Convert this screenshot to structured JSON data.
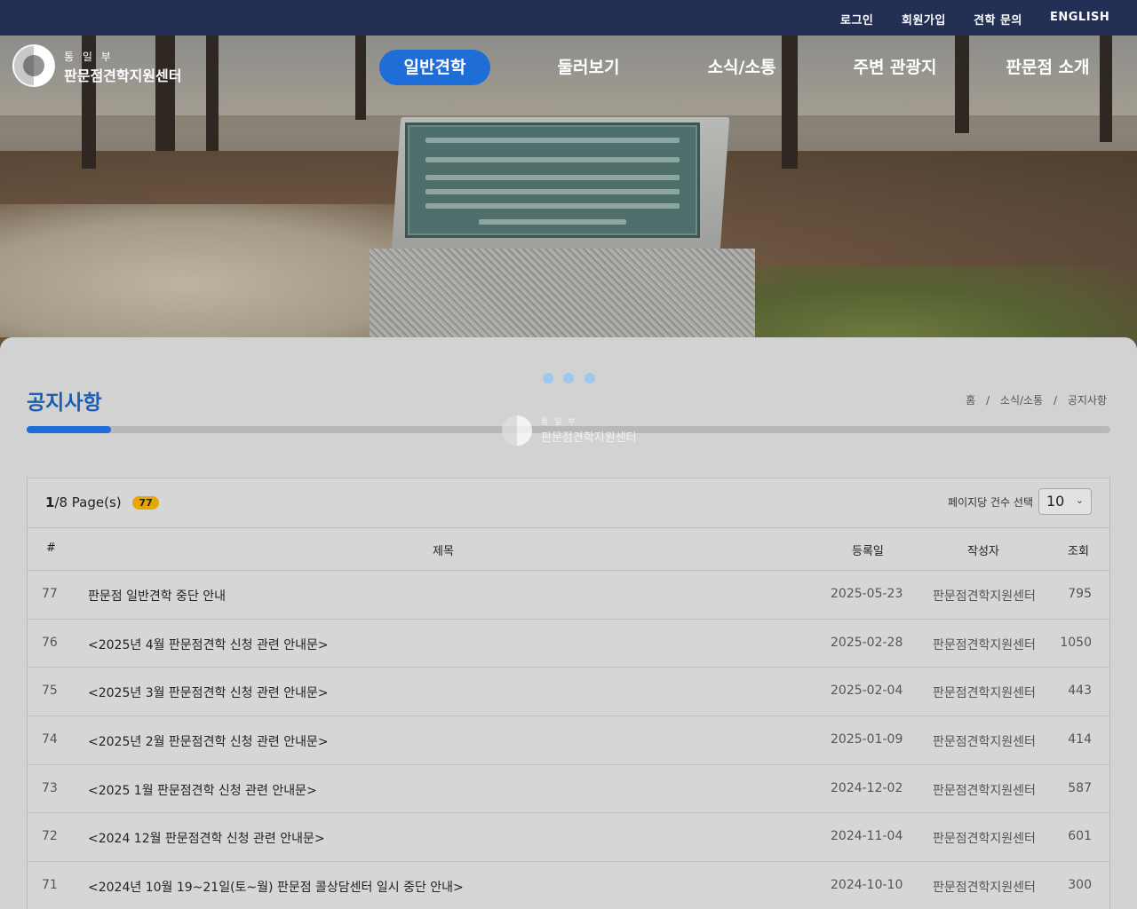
{
  "topbar": {
    "login": "로그인",
    "signup": "회원가입",
    "inquiry": "견학 문의",
    "english": "ENGLISH"
  },
  "logo": {
    "ministry": "통 일 부",
    "center": "판문점견학지원센터"
  },
  "nav": {
    "items": [
      "일반견학",
      "둘러보기",
      "소식/소통",
      "주변 관광지",
      "판문점 소개"
    ],
    "active_index": 0
  },
  "page": {
    "title": "공지사항",
    "breadcrumb": [
      "홈",
      "소식/소통",
      "공지사항"
    ],
    "breadcrumb_sep": "/",
    "progress_fraction": 0.078
  },
  "watermark": {
    "ministry": "통 일 부",
    "center": "판문점견학지원센터"
  },
  "board": {
    "current_page": "1",
    "page_suffix": "/8 Page(s)",
    "total_count": "77",
    "perpage_label": "페이지당 건수 선택",
    "perpage_value": "10",
    "columns": {
      "num": "#",
      "title": "제목",
      "date": "등록일",
      "author": "작성자",
      "views": "조회"
    },
    "rows": [
      {
        "num": "77",
        "title": "판문점 일반견학 중단 안내",
        "date": "2025-05-23",
        "author": "판문점견학지원센터",
        "views": "795"
      },
      {
        "num": "76",
        "title": "<2025년 4월 판문점견학 신청 관련 안내문>",
        "date": "2025-02-28",
        "author": "판문점견학지원센터",
        "views": "1050"
      },
      {
        "num": "75",
        "title": "<2025년 3월 판문점견학 신청 관련 안내문>",
        "date": "2025-02-04",
        "author": "판문점견학지원센터",
        "views": "443"
      },
      {
        "num": "74",
        "title": "<2025년 2월 판문점견학 신청 관련 안내문>",
        "date": "2025-01-09",
        "author": "판문점견학지원센터",
        "views": "414"
      },
      {
        "num": "73",
        "title": "<2025 1월 판문점견학 신청 관련 안내문>",
        "date": "2024-12-02",
        "author": "판문점견학지원센터",
        "views": "587"
      },
      {
        "num": "72",
        "title": "<2024 12월 판문점견학 신청 관련 안내문>",
        "date": "2024-11-04",
        "author": "판문점견학지원센터",
        "views": "601"
      },
      {
        "num": "71",
        "title": "<2024년 10월 19~21일(토~월) 판문점 콜상담센터 일시 중단 안내>",
        "date": "2024-10-10",
        "author": "판문점견학지원센터",
        "views": "300"
      }
    ]
  },
  "colors": {
    "accent": "#1f6dd6",
    "title_blue": "#1a5fb4",
    "topbar": "#1c2a52",
    "badge": "#e6a800"
  }
}
